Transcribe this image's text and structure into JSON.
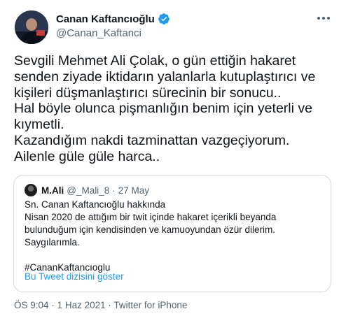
{
  "author": {
    "display_name": "Canan Kaftancıoğlu",
    "handle": "@Canan_Kaftanci",
    "verified": true,
    "verified_color": "#1d9bf0"
  },
  "tweet": {
    "lines": [
      "Sevgili Mehmet Ali Çolak, o gün ettiğin hakaret",
      "senden ziyade iktidarın yalanlarla kutuplaştırıcı ve",
      "kişileri düşmanlaştırıcı sürecinin bir sonucu..",
      "Hal böyle olunca pişmanlığın benim için yeterli ve",
      "kıymetli.",
      "Kazandığım nakdi tazminattan vazgeçiyorum.",
      "Ailenle güle güle harca.."
    ]
  },
  "quoted": {
    "name": "M.Ali",
    "handle": "@_Mali_8",
    "separator": "·",
    "date": "27 May",
    "lines": [
      "Sn. Canan Kaftancıoğlu hakkında",
      "Nisan 2020 de attığım bir twit içinde hakaret içerikli beyanda",
      "bulunduğum için kendisinden ve kamuoyundan özür dilerim.",
      "Saygılarımla."
    ],
    "hashtag": "#CananKaftancıoglu",
    "thread_link": "Bu Tweet dizisini göster"
  },
  "meta": {
    "time": "ÖS 9:04",
    "date": "1 Haz 2021",
    "separator": "·",
    "source": "Twitter for iPhone"
  },
  "icons": {
    "more": "more-options-icon",
    "verified": "verified-badge-icon"
  },
  "colors": {
    "link": "#1d9bf0",
    "secondary_text": "#536471",
    "border": "#cfd9de"
  }
}
